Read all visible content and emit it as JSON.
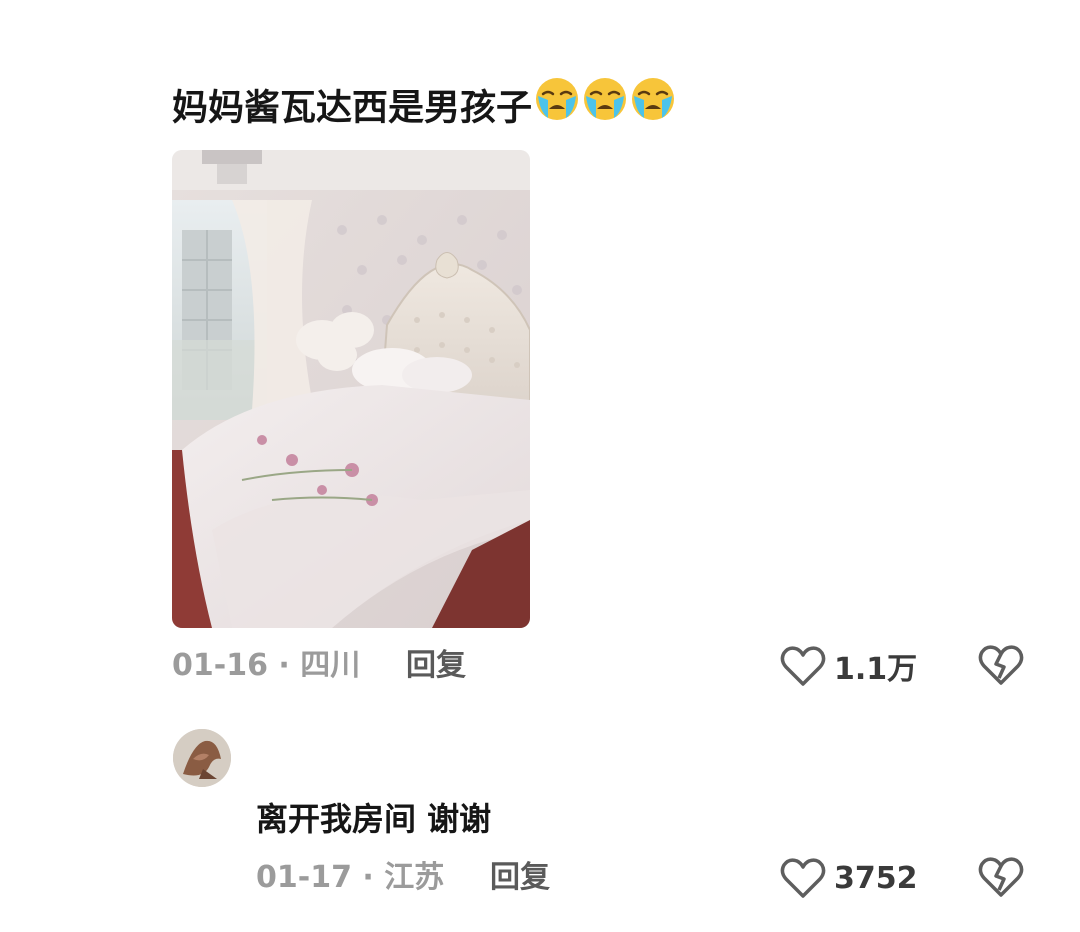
{
  "comment": {
    "text": "妈妈酱瓦达西是男孩子",
    "emojis": [
      "loudly-crying-face",
      "loudly-crying-face",
      "loudly-crying-face"
    ],
    "date_location": "01-16 · 四川",
    "reply_label": "回复",
    "like_count": "1.1万"
  },
  "reply": {
    "text": "离开我房间 谢谢",
    "date_location": "01-17 · 江苏",
    "reply_label": "回复",
    "like_count": "3752"
  },
  "colors": {
    "meta_gray": "#9b9b9b",
    "text_dark": "#161616",
    "icon_gray": "#6a6a6a"
  }
}
